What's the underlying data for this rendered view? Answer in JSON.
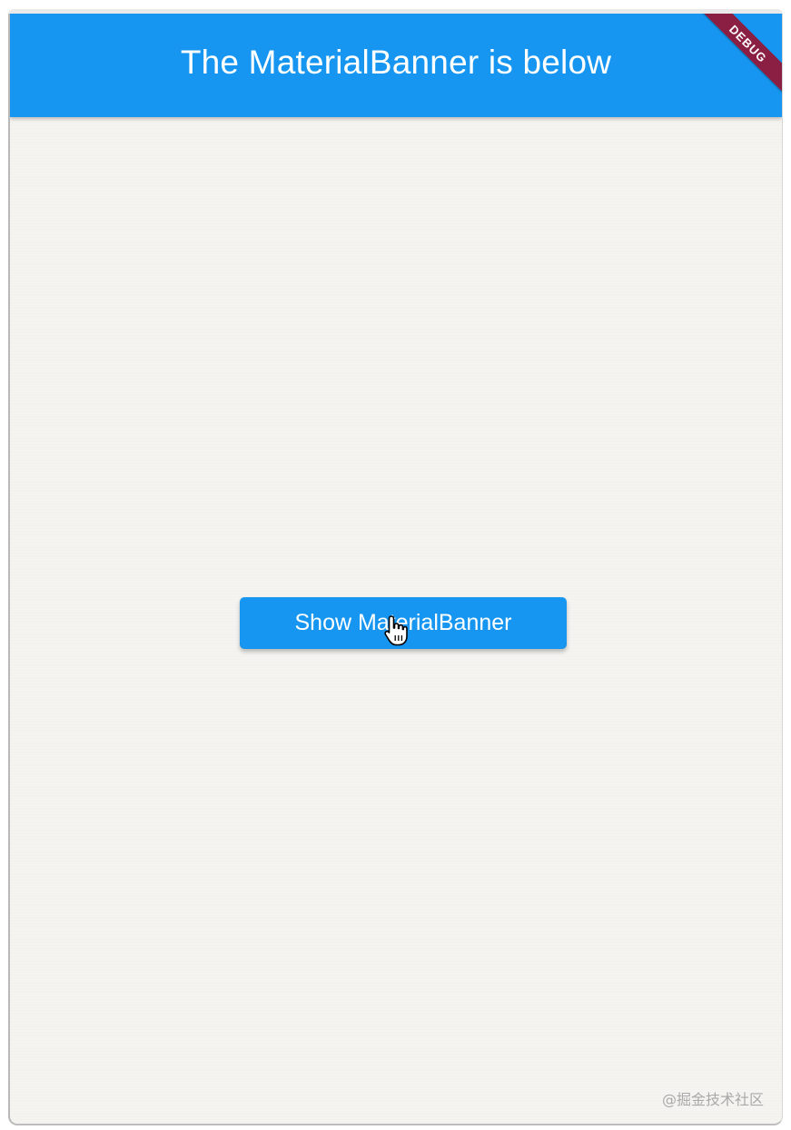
{
  "app_bar": {
    "title": "The MaterialBanner is below"
  },
  "debug_banner": {
    "label": "DEBUG",
    "color": "#8b1f43"
  },
  "main": {
    "button_label": "Show MaterialBanner"
  },
  "watermark": {
    "text": "@掘金技术社区"
  },
  "colors": {
    "primary": "#1696f1",
    "background": "#f5f4f1"
  },
  "icons": {
    "cursor": "hand-pointer-icon"
  }
}
